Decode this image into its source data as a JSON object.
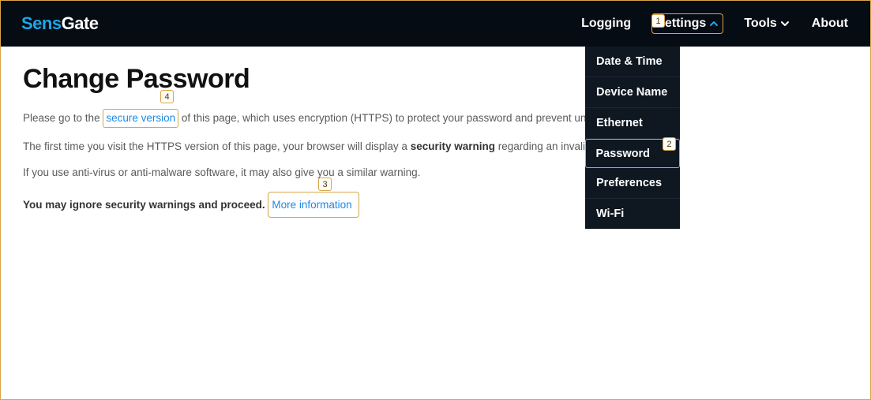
{
  "brand": {
    "part1": "Sens",
    "part2": "Gate"
  },
  "nav": {
    "logging": "Logging",
    "settings": "Settings",
    "tools": "Tools",
    "about": "About"
  },
  "settings_menu": {
    "items": [
      {
        "label": "Date & Time"
      },
      {
        "label": "Device Name"
      },
      {
        "label": "Ethernet"
      },
      {
        "label": "Password",
        "active": true
      },
      {
        "label": "Preferences"
      },
      {
        "label": "Wi-Fi"
      }
    ]
  },
  "page": {
    "title": "Change Password",
    "p1_a": "Please go to the ",
    "p1_link": "secure version",
    "p1_b": " of this page, which uses encryption (HTTPS) to protect your password and prevent unauthorized access.",
    "p2_a": "The first time you visit the HTTPS version of this page, your browser will display a ",
    "p2_strong": "security warning",
    "p2_b": " regarding an invalid certificate.",
    "p3": "If you use anti-virus or anti-malware software, it may also give you a similar warning.",
    "p4_strong": "You may ignore security warnings and proceed.",
    "p4_link": "More information"
  },
  "callouts": {
    "c1": "1",
    "c2": "2",
    "c3": "3",
    "c4": "4"
  }
}
